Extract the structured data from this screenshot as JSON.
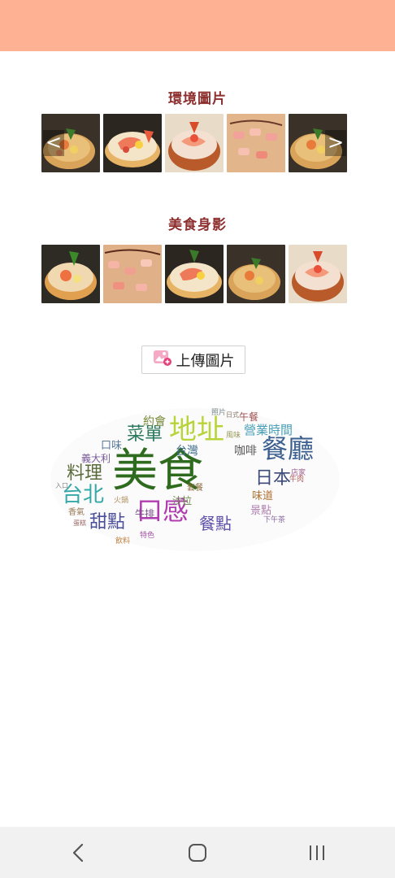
{
  "environment_section": {
    "title": "環境圖片",
    "prev_arrow": "<",
    "next_arrow": ">"
  },
  "food_section": {
    "title": "美食身影"
  },
  "upload": {
    "label": "上傳圖片",
    "icon": "image-add-icon"
  },
  "word_cloud": {
    "words": [
      {
        "text": "美食",
        "color": "#2f6b1e"
      },
      {
        "text": "地址",
        "color": "#b8d43a"
      },
      {
        "text": "餐廳",
        "color": "#3b5f8f"
      },
      {
        "text": "口感",
        "color": "#b03cb0"
      },
      {
        "text": "台北",
        "color": "#36a8a8"
      },
      {
        "text": "甜點",
        "color": "#4b4f9a"
      },
      {
        "text": "餐點",
        "color": "#5e4fa8"
      },
      {
        "text": "日本",
        "color": "#3d4a7a"
      },
      {
        "text": "菜單",
        "color": "#2b7a5e"
      },
      {
        "text": "料理",
        "color": "#5a6a3a"
      },
      {
        "text": "營業時間",
        "color": "#4aa0b8"
      },
      {
        "text": "約會",
        "color": "#7a8a3a"
      },
      {
        "text": "台灣",
        "color": "#3d6a8a"
      },
      {
        "text": "咖啡",
        "color": "#5a5a5a"
      },
      {
        "text": "午餐",
        "color": "#a05050"
      },
      {
        "text": "口味",
        "color": "#5a7a9a"
      },
      {
        "text": "義大利",
        "color": "#7a5a9a"
      },
      {
        "text": "味道",
        "color": "#b07030"
      },
      {
        "text": "景點",
        "color": "#b080b0"
      },
      {
        "text": "牛排",
        "color": "#7a4a8a"
      },
      {
        "text": "沙拉",
        "color": "#6a8a4a"
      },
      {
        "text": "套餐",
        "color": "#8a6a3a"
      },
      {
        "text": "香氣",
        "color": "#9a7a5a"
      },
      {
        "text": "特色",
        "color": "#a050a0"
      },
      {
        "text": "飲料",
        "color": "#c08040"
      },
      {
        "text": "店家",
        "color": "#a06090"
      },
      {
        "text": "照片",
        "color": "#7a8a8a"
      },
      {
        "text": "日式",
        "color": "#8a7a6a"
      },
      {
        "text": "風味",
        "color": "#9a9a5a"
      },
      {
        "text": "牛肉",
        "color": "#b05a5a"
      },
      {
        "text": "下午茶",
        "color": "#8a6aa0"
      },
      {
        "text": "入口",
        "color": "#8a8a8a"
      },
      {
        "text": "蛋糕",
        "color": "#a06a6a"
      },
      {
        "text": "火鍋",
        "color": "#b09060"
      }
    ]
  },
  "bottom_nav": {
    "back": "back-icon",
    "home": "home-icon",
    "recents": "recents-icon"
  }
}
